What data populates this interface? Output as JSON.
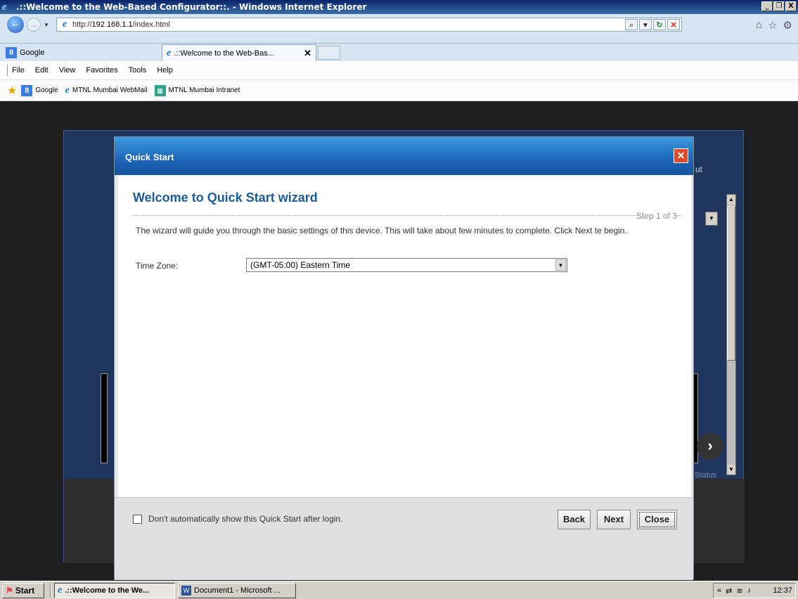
{
  "window": {
    "title": ".::Welcome to the Web-Based Configurator::. - Windows Internet Explorer",
    "controls": [
      "_",
      "И",
      "X"
    ]
  },
  "address": {
    "prefix": "http://",
    "host": "192.168.1.1",
    "path": "/index.html"
  },
  "tabs": [
    {
      "label": "Google"
    },
    {
      "label": ".::Welcome to the Web-Bas...",
      "close": "✕"
    }
  ],
  "menu": [
    "File",
    "Edit",
    "View",
    "Favorites",
    "Tools",
    "Help"
  ],
  "favorites": [
    {
      "label": "Google",
      "icon": "google-icon"
    },
    {
      "label": "MTNL Mumbai WebMail",
      "icon": "ie-icon"
    },
    {
      "label": "MTNL Mumbai Intranet",
      "icon": "mtnl-icon"
    }
  ],
  "background_page": {
    "ghost_text": "ut",
    "status_text": "Status"
  },
  "dialog": {
    "title": "Quick Start",
    "wizard_title": "Welcome to Quick Start wizard",
    "step": "Step 1 of 3",
    "description": "The wizard will guide you through the basic settings of this device. This will take about few minutes to complete. Click Next te begin.",
    "time_zone_label": "Time Zone:",
    "time_zone_value": "(GMT-05:00) Eastern Time",
    "checkbox_label": "Don't automatically show this Quick Start after login.",
    "buttons": {
      "back": "Back",
      "next": "Next",
      "close": "Close"
    }
  },
  "taskbar": {
    "start": "Start",
    "items": [
      {
        "label": ".::Welcome to the We...",
        "active": true
      },
      {
        "label": "Document1 - Microsoft ...",
        "active": false
      }
    ],
    "tray_expand": "«",
    "clock": "12:37"
  },
  "colors": {
    "dialog_header": "#1d66b8",
    "wizard_title": "#1e5c99",
    "close_red": "#e34a2c"
  }
}
